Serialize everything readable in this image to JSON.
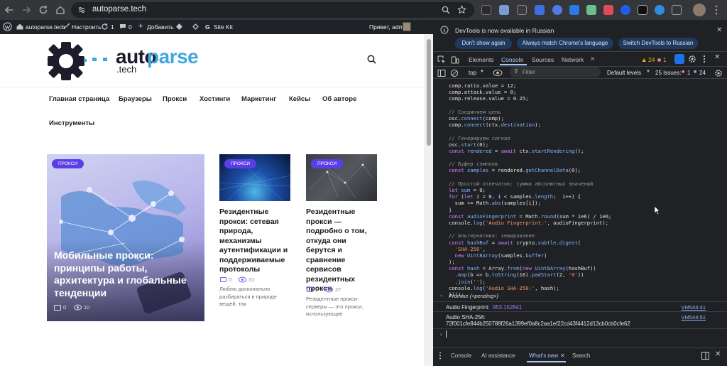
{
  "browser": {
    "url": "autoparse.tech"
  },
  "wp_admin_bar": {
    "site": "autoparse.tech",
    "customize": "Настроить",
    "updates": "1",
    "comments": "0",
    "add_new": "Добавить",
    "site_kit": "Site Kit",
    "greeting": "Привет, admin"
  },
  "site": {
    "logo": {
      "auto": "auto",
      "parse": "parse",
      "tech": ".tech"
    },
    "menu": [
      "Главная страница",
      "Браузеры",
      "Прокси",
      "Хостинги",
      "Маркетинг",
      "Кейсы",
      "Об авторе",
      "Инструменты"
    ],
    "cards": [
      {
        "tag": "ПРОКСИ",
        "title": "Мобильные прокси: принципы работы, архитектура и глобальные тенденции",
        "comments": "0",
        "views": "10"
      },
      {
        "tag": "ПРОКСИ",
        "title": "Резидентные прокси: сетевая природа, механизмы аутентификации и поддерживаемые протоколы",
        "comments": "0",
        "views": "31",
        "excerpt": "Люблю досконально разбираться в природе вещей, так"
      },
      {
        "tag": "ПРОКСИ",
        "title": "Резидентные прокси — подробно о том, откуда они берутся и сравнение сервисов резидентных прокси",
        "comments": "0",
        "views": "27",
        "excerpt": "Резидентные прокси-серверы — это прокси, использующие"
      }
    ]
  },
  "devtools": {
    "notice": "DevTools is now available in Russian",
    "btn_dont_show": "Don't show again",
    "btn_match": "Always match Chrome's language",
    "btn_switch": "Switch DevTools to Russian",
    "tabs": [
      "Elements",
      "Console",
      "Sources",
      "Network"
    ],
    "more_tabs": "»",
    "warn_count": "24",
    "err_count": "1",
    "context": "top",
    "filter_placeholder": "Filter",
    "levels": "Default levels",
    "issues_label": "25 Issues:",
    "issues_err": "1",
    "issues_info": "24",
    "code": [
      [
        [
          "",
          "comp.ratio.value = 12;"
        ]
      ],
      [
        [
          "",
          "comp.attack.value = 0;"
        ]
      ],
      [
        [
          "",
          "comp.release.value = 0.25;"
        ]
      ],
      [],
      [
        [
          "cm",
          "// Соединяем цепь"
        ]
      ],
      [
        [
          "",
          "osc."
        ],
        [
          "fn",
          "connect"
        ],
        [
          "",
          "(comp);"
        ]
      ],
      [
        [
          "",
          "comp."
        ],
        [
          "fn",
          "connect"
        ],
        [
          "",
          "(ctx."
        ],
        [
          "fn",
          "destination"
        ],
        [
          "",
          "); "
        ]
      ],
      [],
      [
        [
          "cm",
          "// Генерируем сигнал"
        ]
      ],
      [
        [
          "",
          "osc."
        ],
        [
          "fn",
          "start"
        ],
        [
          "",
          "(0);"
        ]
      ],
      [
        [
          "kw",
          "const "
        ],
        [
          "fn",
          "rendered"
        ],
        [
          "",
          " = "
        ],
        [
          "kw",
          "await "
        ],
        [
          "",
          "ctx."
        ],
        [
          "fn",
          "startRendering"
        ],
        [
          "",
          "();"
        ]
      ],
      [],
      [
        [
          "cm",
          "// Буфер сэмплов"
        ]
      ],
      [
        [
          "kw",
          "const "
        ],
        [
          "fn",
          "samples"
        ],
        [
          "",
          " = rendered."
        ],
        [
          "fn",
          "getChannelData"
        ],
        [
          "",
          "(0);"
        ]
      ],
      [],
      [
        [
          "cm",
          "// Простой отпечаток: сумма абсолютных значений"
        ]
      ],
      [
        [
          "kw",
          "let "
        ],
        [
          "fn",
          "sum"
        ],
        [
          "",
          " = 0;"
        ]
      ],
      [
        [
          "kw",
          "for "
        ],
        [
          "",
          "("
        ],
        [
          "kw",
          "let "
        ],
        [
          "",
          "i = 0, i < samples."
        ],
        [
          "fn",
          "length"
        ],
        [
          "",
          ";  i++) {"
        ]
      ],
      [
        [
          "",
          "  sum += Math."
        ],
        [
          "fn",
          "abs"
        ],
        [
          "",
          "(samples[i]);"
        ]
      ],
      [
        [
          "",
          "}"
        ]
      ],
      [
        [
          "kw",
          "const "
        ],
        [
          "fn",
          "audioFingerprint"
        ],
        [
          "",
          " = Math."
        ],
        [
          "fn",
          "round"
        ],
        [
          "",
          "(sum * 1e6) / 1e6;"
        ]
      ],
      [
        [
          "",
          "console."
        ],
        [
          "fn",
          "log"
        ],
        [
          "",
          "("
        ],
        [
          "st",
          "'Audio Fingerprint:'"
        ],
        [
          "",
          ", audioFingerprint);"
        ]
      ],
      [],
      [
        [
          "cm",
          "// Альтернатива: хеширование"
        ]
      ],
      [
        [
          "kw",
          "const "
        ],
        [
          "fn",
          "hashBuf"
        ],
        [
          "",
          " = "
        ],
        [
          "kw",
          "await "
        ],
        [
          "",
          "crypto."
        ],
        [
          "fn",
          "subtle"
        ],
        [
          "",
          "."
        ],
        [
          "fn",
          "digest"
        ],
        [
          "",
          "("
        ]
      ],
      [
        [
          "st",
          "  'SHA-256'"
        ],
        [
          "",
          ","
        ]
      ],
      [
        [
          "kw",
          "  new "
        ],
        [
          "fn",
          "Uint8Array"
        ],
        [
          "",
          "(samples."
        ],
        [
          "fn",
          "buffer"
        ],
        [
          "",
          ")"
        ]
      ],
      [
        [
          "",
          ");"
        ]
      ],
      [
        [
          "kw",
          "const "
        ],
        [
          "fn",
          "hash"
        ],
        [
          "",
          " = Array."
        ],
        [
          "fn",
          "from"
        ],
        [
          "",
          "("
        ],
        [
          "kw",
          "new "
        ],
        [
          "fn",
          "Uint8Array"
        ],
        [
          "",
          "(hashBuf))"
        ]
      ],
      [
        [
          "",
          "  ."
        ],
        [
          "fn",
          "map"
        ],
        [
          "",
          "(b => b."
        ],
        [
          "fn",
          "toString"
        ],
        [
          "",
          "(16)."
        ],
        [
          "fn",
          "padStart"
        ],
        [
          "",
          "(2, "
        ],
        [
          "st",
          "'0'"
        ],
        [
          "",
          "))"
        ]
      ],
      [
        [
          "",
          "  ."
        ],
        [
          "fn",
          "join"
        ],
        [
          "",
          "("
        ],
        [
          "st",
          "''"
        ],
        [
          "",
          ");"
        ]
      ],
      [
        [
          "",
          "console."
        ],
        [
          "fn",
          "log"
        ],
        [
          "",
          "("
        ],
        [
          "st",
          "'Audio SHA-256:'"
        ],
        [
          "",
          ", hash);"
        ]
      ],
      [
        [
          "",
          "})();"
        ]
      ]
    ],
    "promise": "Promise {<pending>}",
    "fp_label": "Audio Fingerprint:",
    "fp_value": "953.152841",
    "fp_src": "VM544:41",
    "sha_label": "Audio SHA-256:",
    "sha_value": "72f001cfe844b250788f26a1399ef0a8c2aa1ef22cd43f4412d13cb0cb0cfe62",
    "sha_src": "VM544:51",
    "bottom_tabs": [
      "Console",
      "AI assistance",
      "What's new",
      "Search"
    ]
  }
}
